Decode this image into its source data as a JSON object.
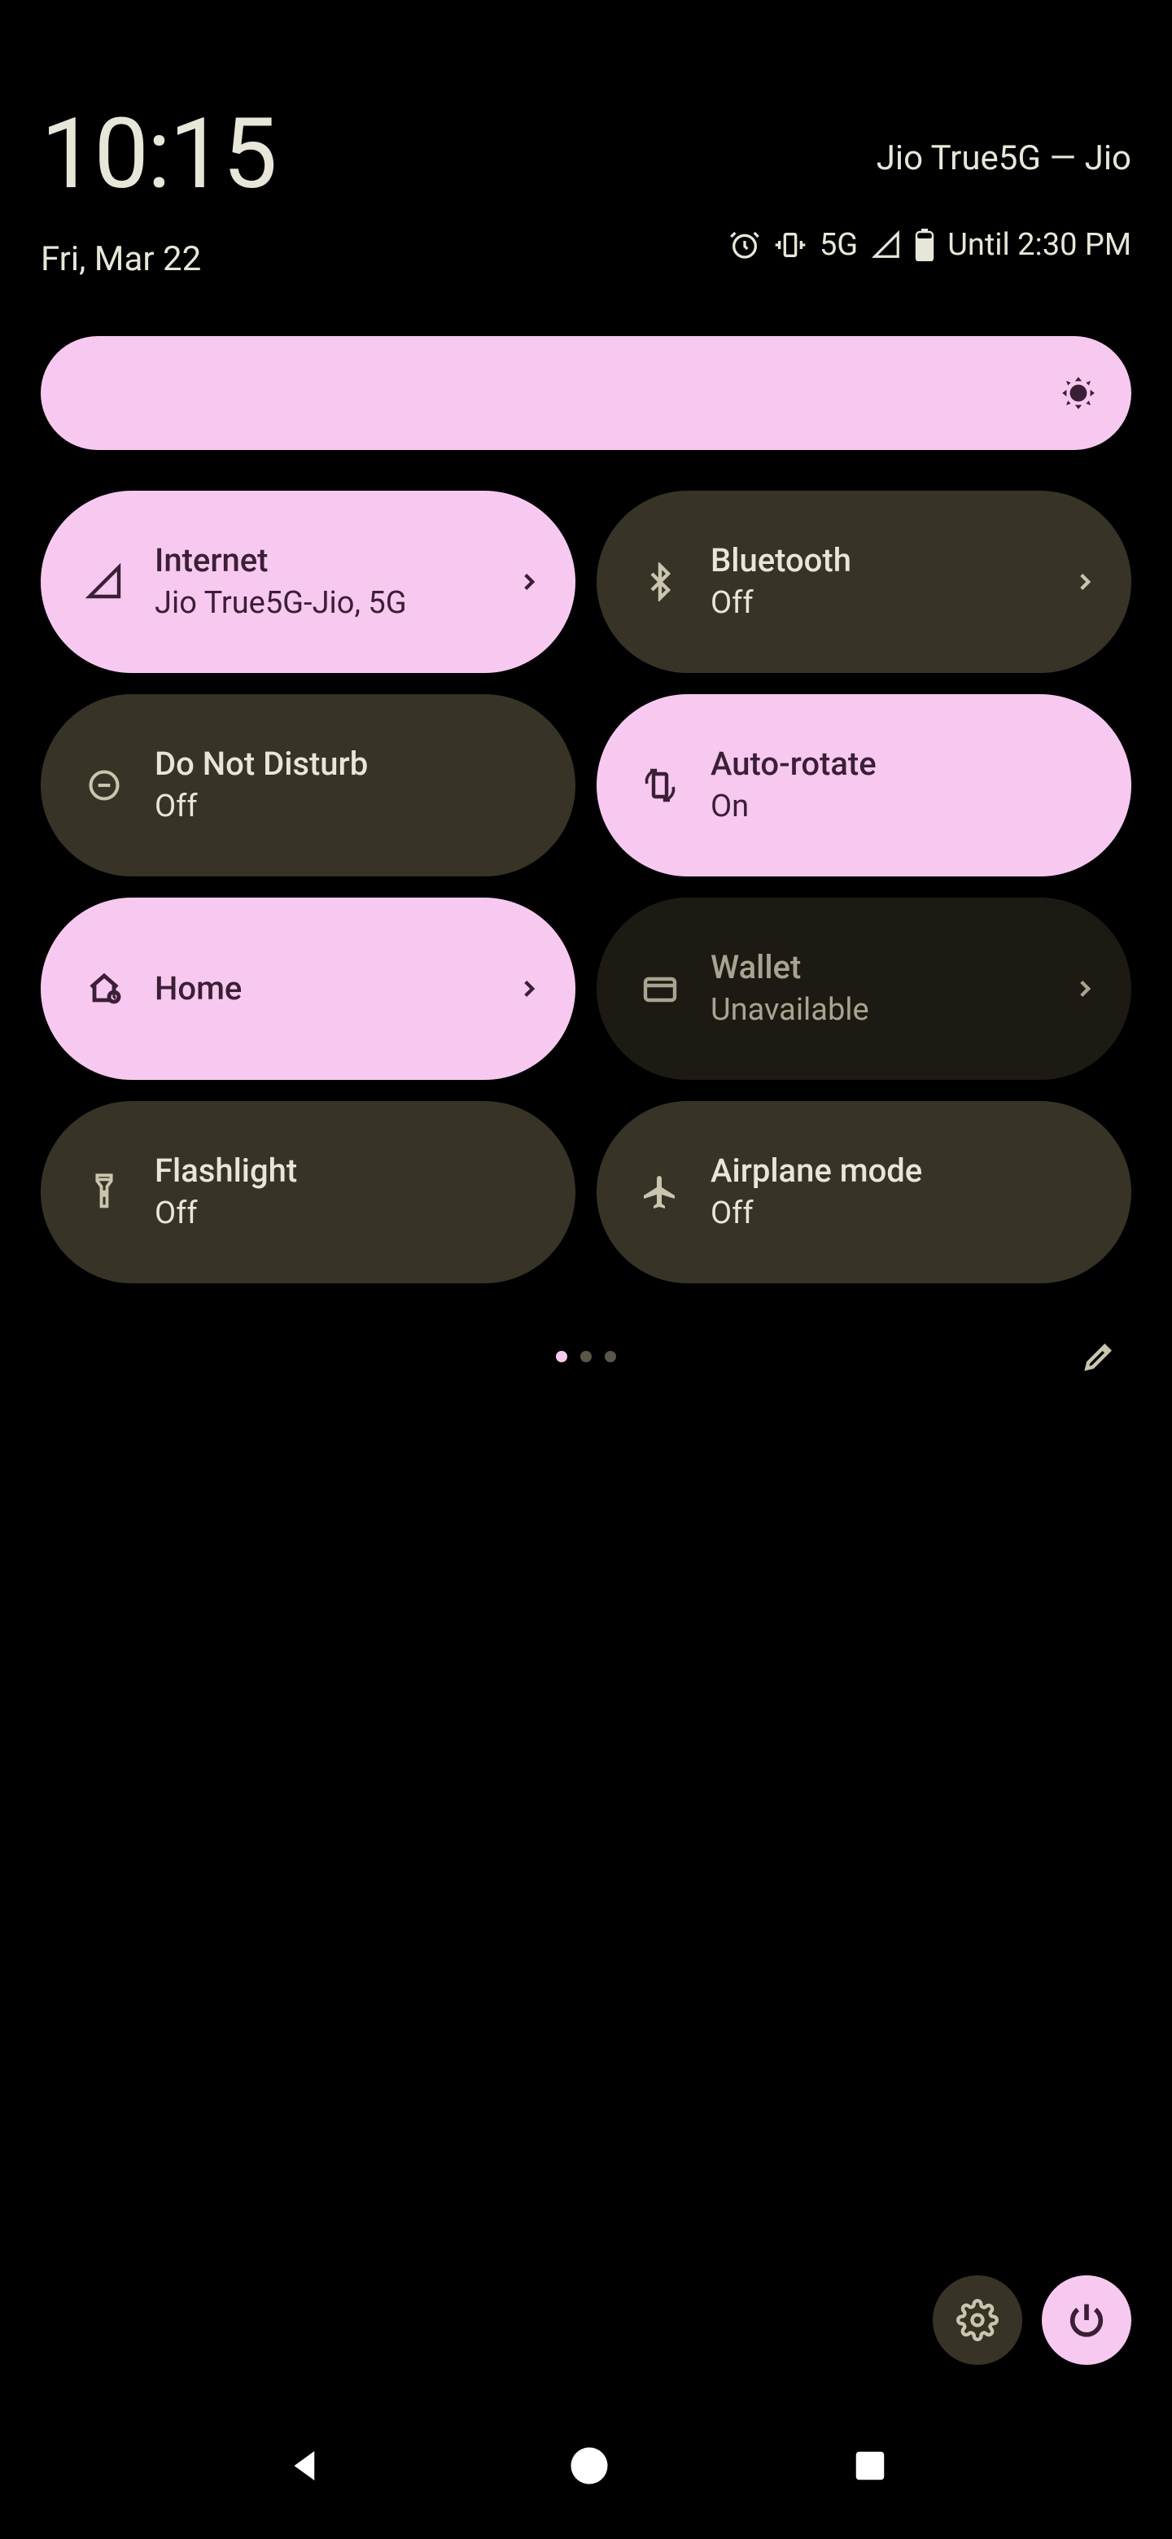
{
  "header": {
    "time": "10:15",
    "date": "Fri, Mar 22",
    "carrier": "Jio True5G — Jio",
    "network_label": "5G",
    "battery_text": "Until 2:30 PM"
  },
  "tiles": {
    "internet": {
      "title": "Internet",
      "sub": "Jio True5G-Jio, 5G"
    },
    "bluetooth": {
      "title": "Bluetooth",
      "sub": "Off"
    },
    "dnd": {
      "title": "Do Not Disturb",
      "sub": "Off"
    },
    "autorotate": {
      "title": "Auto-rotate",
      "sub": "On"
    },
    "home": {
      "title": "Home"
    },
    "wallet": {
      "title": "Wallet",
      "sub": "Unavailable"
    },
    "flashlight": {
      "title": "Flashlight",
      "sub": "Off"
    },
    "airplane": {
      "title": "Airplane mode",
      "sub": "Off"
    }
  }
}
